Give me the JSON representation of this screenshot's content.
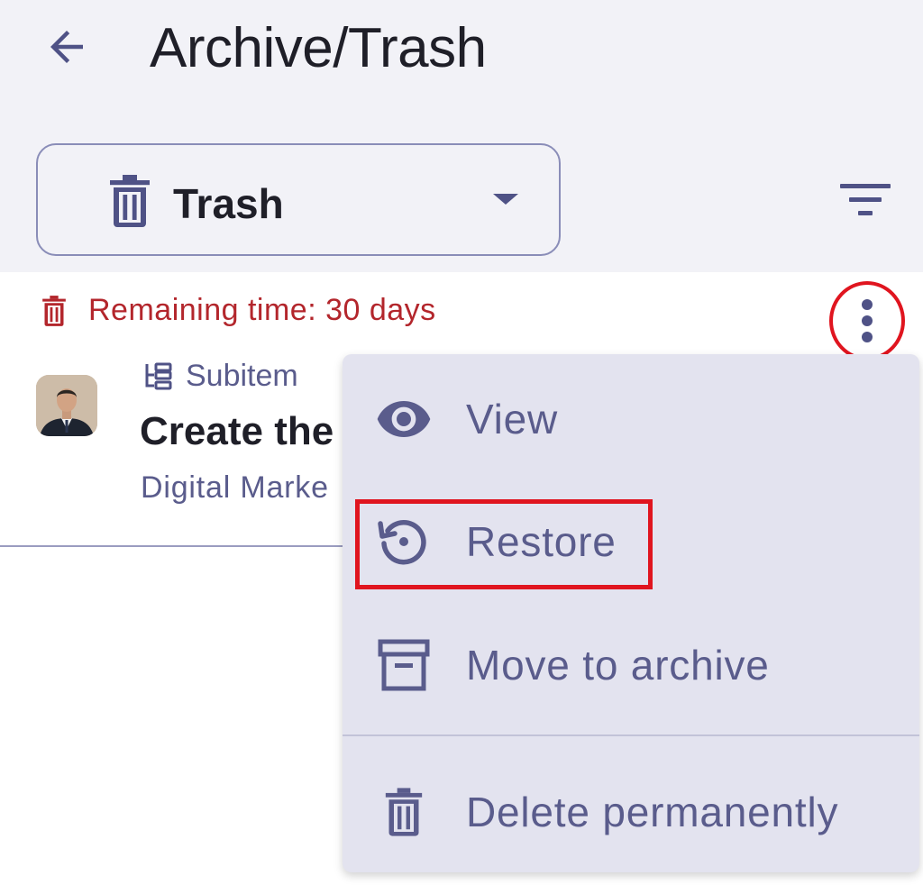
{
  "header": {
    "title": "Archive/Trash",
    "back_icon": "arrow-left-icon"
  },
  "view_selector": {
    "icon": "trash-icon",
    "selected": "Trash"
  },
  "filter": {
    "icon": "filter-icon"
  },
  "item": {
    "remaining_time": "Remaining time: 30 days",
    "type_label": "Subitem",
    "title": "Create the",
    "board": "Digital Marke"
  },
  "menu": {
    "items": [
      {
        "label": "View",
        "icon": "eye-icon"
      },
      {
        "label": "Restore",
        "icon": "restore-icon"
      },
      {
        "label": "Move to archive",
        "icon": "archive-icon"
      },
      {
        "label": "Delete permanently",
        "icon": "trash-icon"
      }
    ]
  },
  "colors": {
    "accent": "#4f5286",
    "danger": "#b3262c",
    "highlight": "#e0151f"
  }
}
